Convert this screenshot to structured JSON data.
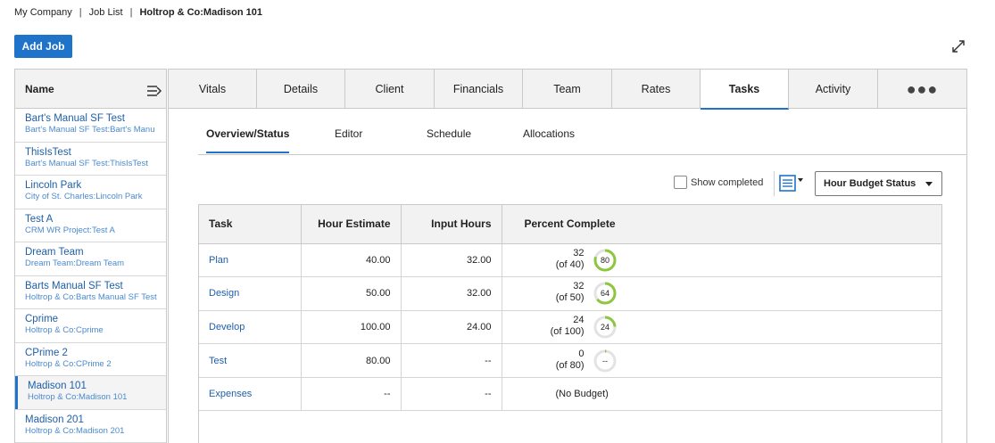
{
  "breadcrumb": {
    "company": "My Company",
    "separator": "|",
    "job_list": "Job List",
    "current": "Holtrop & Co:Madison 101"
  },
  "toolbar": {
    "add_job_label": "Add Job"
  },
  "joblist": {
    "header": "Name",
    "items": [
      {
        "name": "Bart's Manual SF Test",
        "sub": "Bart's Manual SF Test:Bart's Manu",
        "selected": false
      },
      {
        "name": "ThisIsTest",
        "sub": "Bart's Manual SF Test:ThisIsTest",
        "selected": false
      },
      {
        "name": "Lincoln Park",
        "sub": "City of St. Charles:Lincoln Park",
        "selected": false
      },
      {
        "name": "Test A",
        "sub": "CRM WR Project:Test A",
        "selected": false
      },
      {
        "name": "Dream Team",
        "sub": "Dream Team:Dream Team",
        "selected": false
      },
      {
        "name": "Barts Manual SF Test",
        "sub": "Holtrop & Co:Barts Manual SF Test",
        "selected": false
      },
      {
        "name": "Cprime",
        "sub": "Holtrop & Co:Cprime",
        "selected": false
      },
      {
        "name": "CPrime 2",
        "sub": "Holtrop & Co:CPrime 2",
        "selected": false
      },
      {
        "name": "Madison 101",
        "sub": "Holtrop & Co:Madison 101",
        "selected": true
      },
      {
        "name": "Madison 201",
        "sub": "Holtrop & Co:Madison 201",
        "selected": false
      }
    ]
  },
  "tabs": [
    {
      "label": "Vitals",
      "active": false
    },
    {
      "label": "Details",
      "active": false
    },
    {
      "label": "Client",
      "active": false
    },
    {
      "label": "Financials",
      "active": false
    },
    {
      "label": "Team",
      "active": false
    },
    {
      "label": "Rates",
      "active": false
    },
    {
      "label": "Tasks",
      "active": true
    },
    {
      "label": "Activity",
      "active": false
    },
    {
      "label": "●●●",
      "active": false
    }
  ],
  "subtabs": [
    {
      "label": "Overview/Status",
      "active": true
    },
    {
      "label": "Editor",
      "active": false
    },
    {
      "label": "Schedule",
      "active": false
    },
    {
      "label": "Allocations",
      "active": false
    }
  ],
  "filters": {
    "show_completed_label": "Show completed",
    "show_completed_checked": false,
    "budget_select_value": "Hour Budget Status"
  },
  "grid": {
    "headers": {
      "task": "Task",
      "hour_estimate": "Hour Estimate",
      "input_hours": "Input Hours",
      "percent_complete": "Percent Complete"
    },
    "rows": [
      {
        "task": "Plan",
        "estimate": "40.00",
        "input": "32.00",
        "pct_line1": "32",
        "pct_line2": "(of 40)",
        "ring_label": "80",
        "ring_value": 0.8
      },
      {
        "task": "Design",
        "estimate": "50.00",
        "input": "32.00",
        "pct_line1": "32",
        "pct_line2": "(of 50)",
        "ring_label": "64",
        "ring_value": 0.64
      },
      {
        "task": "Develop",
        "estimate": "100.00",
        "input": "24.00",
        "pct_line1": "24",
        "pct_line2": "(of 100)",
        "ring_label": "24",
        "ring_value": 0.24
      },
      {
        "task": "Test",
        "estimate": "80.00",
        "input": "--",
        "pct_line1": "0",
        "pct_line2": "(of 80)",
        "ring_label": "--",
        "ring_value": 0.02
      },
      {
        "task": "Expenses",
        "estimate": "--",
        "input": "--",
        "pct_line1": "(No Budget)",
        "pct_line2": "",
        "ring_label": "",
        "ring_value": null
      }
    ]
  },
  "colors": {
    "accent": "#1f73c9",
    "ring_fill": "#8dc63f",
    "ring_track": "#e3e3e3",
    "link": "#1f5fa8"
  }
}
